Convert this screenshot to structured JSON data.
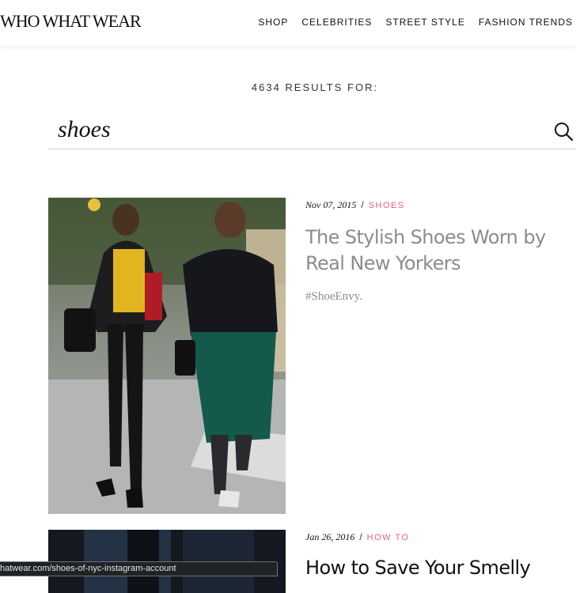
{
  "header": {
    "logo": "WHO WHAT WEAR",
    "nav": [
      "SHOP",
      "CELEBRITIES",
      "STREET STYLE",
      "FASHION TRENDS"
    ]
  },
  "search": {
    "results_label": "4634 RESULTS FOR:",
    "query": "shoes",
    "icon": "search-icon"
  },
  "articles": [
    {
      "date": "Nov 07, 2015",
      "separator": "/",
      "category": "SHOES",
      "title": "The Stylish Shoes Worn by Real New Yorkers",
      "dek": "#ShoeEnvy."
    },
    {
      "date": "Jan 26, 2016",
      "separator": "/",
      "category": "HOW TO",
      "title": "How to Save Your Smelly"
    }
  ],
  "colors": {
    "accent": "#e2647b",
    "title_gray": "#8c8c8c"
  },
  "status_bar": {
    "url": "hatwear.com/shoes-of-nyc-instagram-account"
  }
}
